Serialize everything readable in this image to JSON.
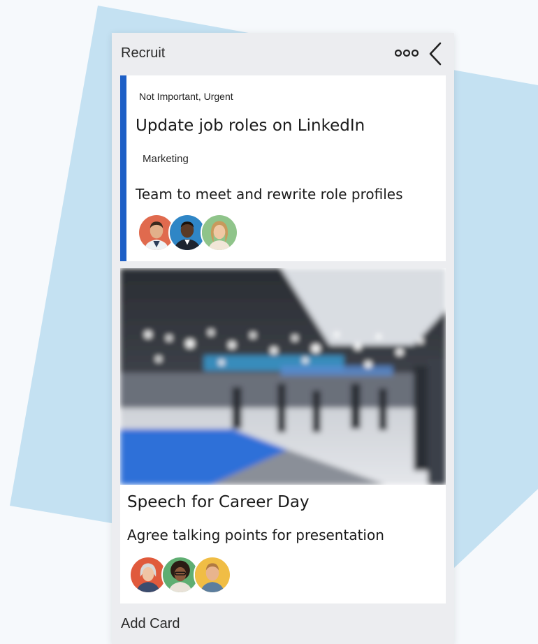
{
  "board": {
    "title": "Recruit",
    "more_icon": "ellipsis-icon",
    "back_icon": "chevron-left-icon",
    "add_card_label": "Add Card"
  },
  "colors": {
    "accent": "#1d5fc6",
    "panel": "#ecedf0",
    "backdrop": "#c4e1f2"
  },
  "cards": [
    {
      "priority": "Not Important, Urgent",
      "title": "Update job roles on LinkedIn",
      "label": "Marketing",
      "description": "Team to meet and rewrite role profiles",
      "avatars": [
        "avatar-man-red-bg",
        "avatar-man-blue-bg",
        "avatar-woman-green-bg"
      ]
    },
    {
      "cover": "blurred-expo-hall-photo",
      "title": "Speech for Career Day",
      "description": "Agree talking points for presentation",
      "avatars": [
        "avatar-older-woman-red-bg",
        "avatar-woman-green-bg",
        "avatar-man-yellow-bg"
      ]
    }
  ]
}
